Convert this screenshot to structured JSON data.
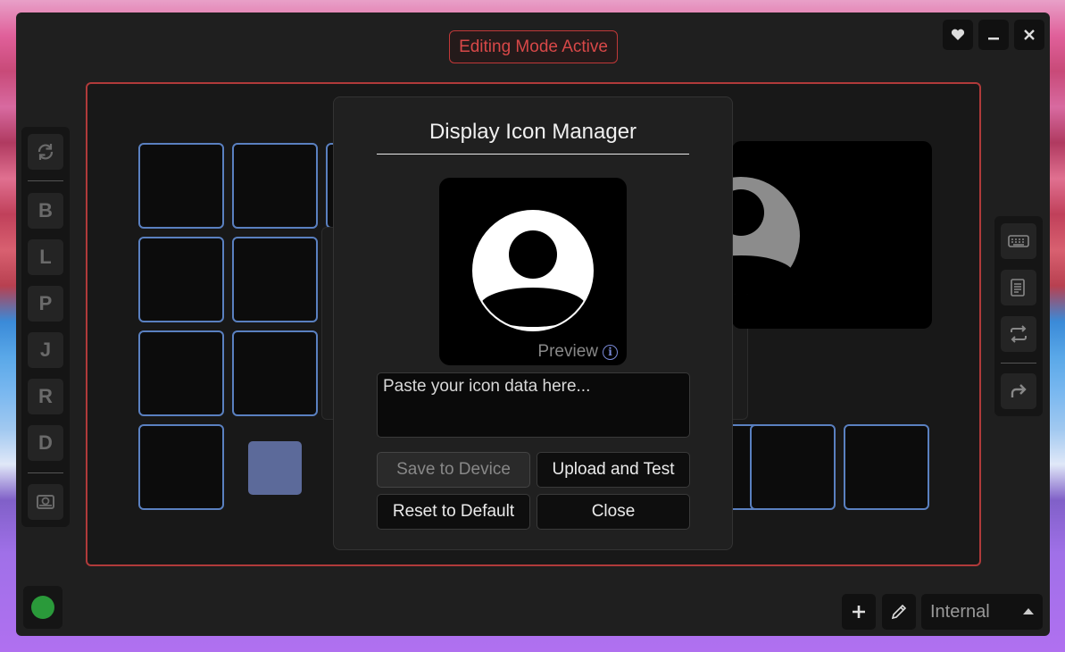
{
  "header": {
    "mode_badge": "Editing Mode Active"
  },
  "window_controls": {
    "favorite_icon": "heart-icon",
    "minimize_icon": "minus-icon",
    "close_icon": "close-icon"
  },
  "left_toolbar": {
    "refresh_icon": "refresh-icon",
    "layers": [
      {
        "label": "B"
      },
      {
        "label": "L"
      },
      {
        "label": "P"
      },
      {
        "label": "J"
      },
      {
        "label": "R"
      },
      {
        "label": "D"
      }
    ],
    "drive_icon": "hard-drive-icon"
  },
  "right_toolbar": {
    "icons": [
      "keyboard-icon",
      "document-icon",
      "swap-icon",
      "redirect-icon"
    ]
  },
  "dialog": {
    "title": "Display Icon Manager",
    "preview_label": "Preview",
    "preview_icon": "user-avatar-icon",
    "textarea_placeholder": "Paste your icon data here...",
    "buttons": {
      "save": "Save to Device",
      "upload": "Upload and Test",
      "reset": "Reset to Default",
      "close": "Close"
    }
  },
  "bottom_bar": {
    "status_color": "#2a9a3a",
    "add_icon": "plus-icon",
    "edit_icon": "pencil-icon",
    "device_select": "Internal"
  },
  "colors": {
    "accent_red": "#b03a3a",
    "key_border": "#5a80c0",
    "filled_key": "#5c6a9a"
  }
}
